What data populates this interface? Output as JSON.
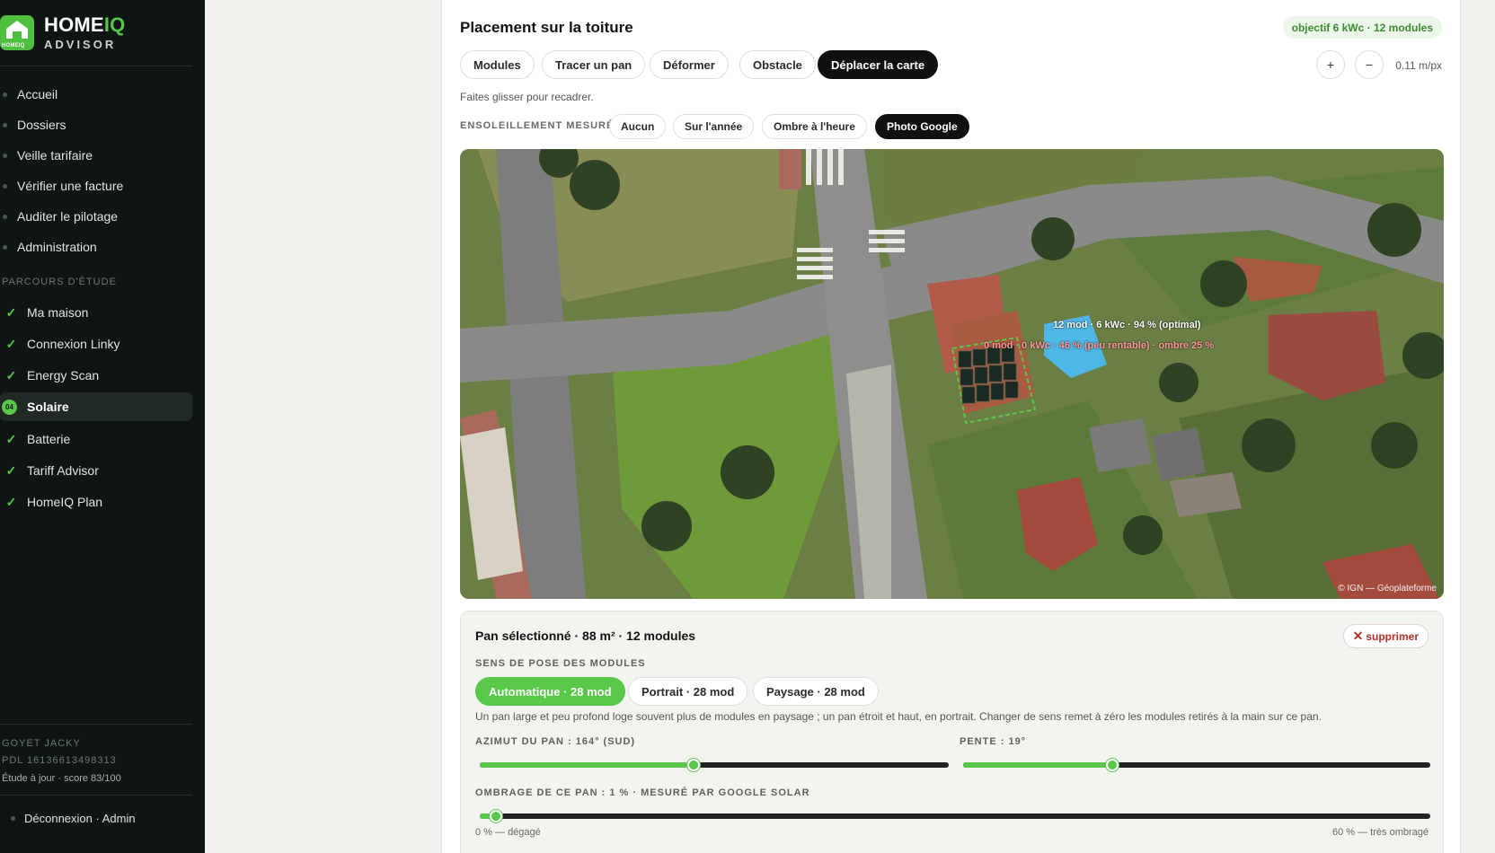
{
  "brand": {
    "name_main": "HOME",
    "name_accent": "IQ",
    "subtitle": "ADVISOR",
    "logo_text": "HOMEIQ"
  },
  "nav": [
    {
      "label": "Accueil"
    },
    {
      "label": "Dossiers"
    },
    {
      "label": "Veille tarifaire"
    },
    {
      "label": "Vérifier une facture"
    },
    {
      "label": "Auditer le pilotage"
    },
    {
      "label": "Administration"
    }
  ],
  "steps_section": "PARCOURS D'ÉTUDE",
  "steps": [
    {
      "label": "Ma maison",
      "state": "done"
    },
    {
      "label": "Connexion Linky",
      "state": "done"
    },
    {
      "label": "Energy Scan",
      "state": "done"
    },
    {
      "label": "Solaire",
      "state": "active",
      "number": "04"
    },
    {
      "label": "Batterie",
      "state": "done"
    },
    {
      "label": "Tariff Advisor",
      "state": "done"
    },
    {
      "label": "HomeIQ Plan",
      "state": "done"
    }
  ],
  "user": {
    "name": "GOYET JACKY",
    "pdl": "PDL 16136613498313",
    "status": "Étude à jour · score 83/100",
    "logout": "Déconnexion · Admin"
  },
  "placement": {
    "title": "Placement sur la toiture",
    "goal": "objectif 6 kWc · 12 modules",
    "tools": [
      "Modules",
      "Tracer un pan",
      "Déformer",
      "Obstacle",
      "Déplacer la carte"
    ],
    "active_tool": "Déplacer la carte",
    "zoom_in": "+",
    "zoom_out": "−",
    "scale": "0.11 m/px",
    "hint": "Faites glisser pour recadrer."
  },
  "sunshine": {
    "label": "ENSOLEILLEMENT MESURÉ",
    "options": [
      "Aucun",
      "Sur l'année",
      "Ombre à l'heure",
      "Photo Google"
    ],
    "active": "Photo Google"
  },
  "map": {
    "label_main": "12 mod · 6 kWc · 94 % (optimal)",
    "label_secondary": "0 mod · 0 kWc · 46 % (peu rentable) · ombre 25 %",
    "attribution": "© IGN — Géoplateforme"
  },
  "pan": {
    "title": "Pan sélectionné · 88 m² · 12 modules",
    "delete": "supprimer",
    "orientation_label": "SENS DE POSE DES MODULES",
    "orientation_options": [
      "Automatique · 28 mod",
      "Portrait · 28 mod",
      "Paysage · 28 mod"
    ],
    "orientation_active": "Automatique · 28 mod",
    "orientation_help": "Un pan large et peu profond loge souvent plus de modules en paysage ; un pan étroit et haut, en portrait. Changer de sens remet à zéro les modules retirés à la main sur ce pan.",
    "azimuth_label": "AZIMUT DU PAN : 164° (SUD)",
    "azimuth_fraction": 0.456,
    "slope_label": "PENTE : 19°",
    "slope_fraction": 0.32,
    "shading_label": "OMBRAGE DE CE PAN : 1 % · MESURÉ PAR GOOGLE SOLAR",
    "shading_fraction": 0.017,
    "shading_min": "0 % — dégagé",
    "shading_max": "60 % — très ombragé"
  },
  "colors": {
    "accent": "#58c74a",
    "sidebar_bg": "#0e1512",
    "danger": "#b3302a"
  }
}
